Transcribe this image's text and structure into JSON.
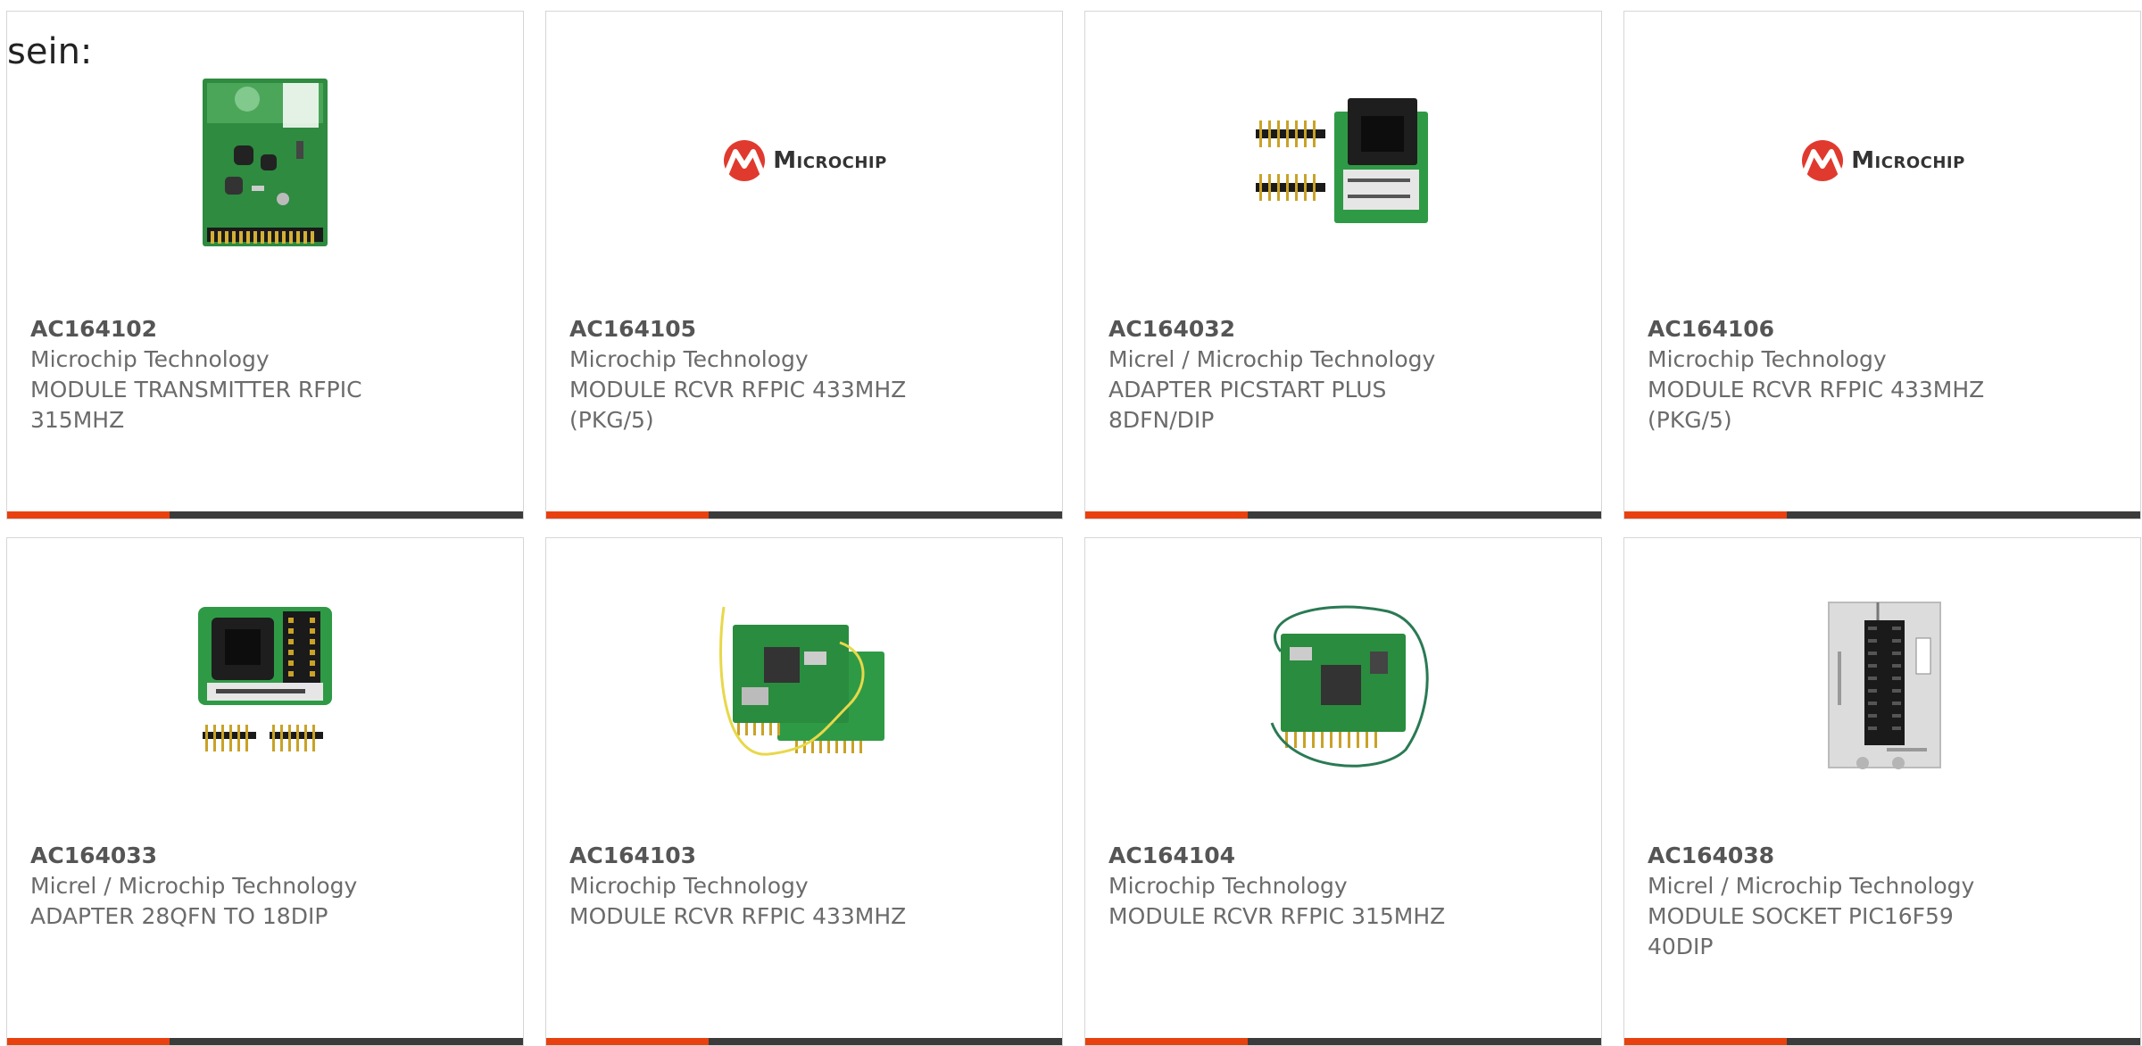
{
  "intro_text": "sein:",
  "colors": {
    "accent": "#e8410f",
    "bar": "#3b3b3b",
    "text": "#6b6b6b",
    "border": "#d6d6d6"
  },
  "products": [
    {
      "part": "AC164102",
      "maker": "Microchip Technology",
      "desc_1": "MODULE TRANSMITTER RFPIC",
      "desc_2": "315MHZ",
      "image": "rf-transmitter-board"
    },
    {
      "part": "AC164105",
      "maker": "Microchip Technology",
      "desc_1": "MODULE RCVR RFPIC 433MHZ",
      "desc_2": "(PKG/5)",
      "image": "microchip-logo",
      "logo_text": "Microchip"
    },
    {
      "part": "AC164032",
      "maker": "Micrel / Microchip Technology",
      "desc_1": "ADAPTER PICSTART PLUS",
      "desc_2": "8DFN/DIP",
      "image": "adapter-with-pin-headers"
    },
    {
      "part": "AC164106",
      "maker": "Microchip Technology",
      "desc_1": "MODULE RCVR RFPIC 433MHZ",
      "desc_2": "(PKG/5)",
      "image": "microchip-logo",
      "logo_text": "Microchip"
    },
    {
      "part": "AC164033",
      "maker": "Micrel / Microchip Technology",
      "desc_1": "ADAPTER 28QFN TO 18DIP",
      "desc_2": "",
      "image": "adapter-with-pin-headers"
    },
    {
      "part": "AC164103",
      "maker": "Microchip Technology",
      "desc_1": "MODULE RCVR RFPIC 433MHZ",
      "desc_2": "",
      "image": "rf-receiver-boards-yellow-antenna"
    },
    {
      "part": "AC164104",
      "maker": "Microchip Technology",
      "desc_1": "MODULE RCVR RFPIC 315MHZ",
      "desc_2": "",
      "image": "rf-receiver-board-green-antenna"
    },
    {
      "part": "AC164038",
      "maker": "Micrel / Microchip Technology",
      "desc_1": "MODULE SOCKET PIC16F59",
      "desc_2": "40DIP",
      "image": "zif-socket-module"
    }
  ]
}
